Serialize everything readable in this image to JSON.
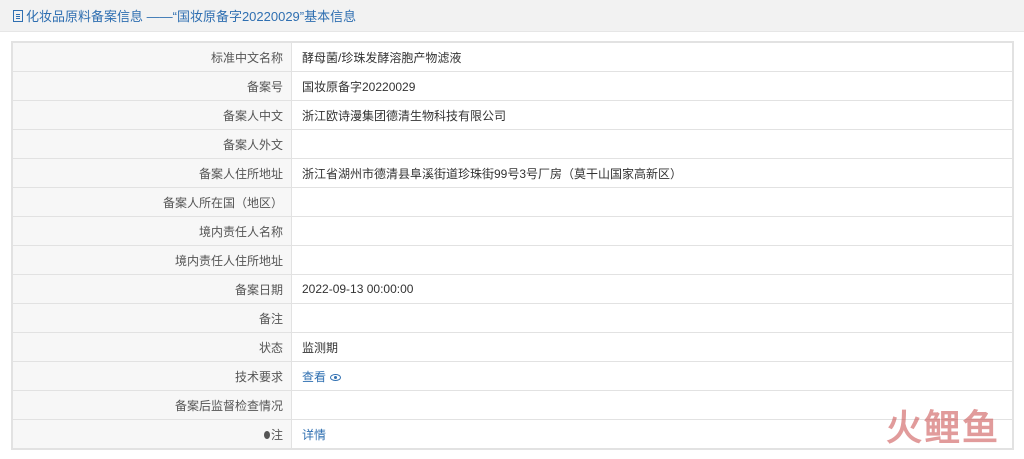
{
  "header": {
    "title": "化妆品原料备案信息 ——“国妆原备字20220029”基本信息"
  },
  "rows": [
    {
      "label": "标准中文名称",
      "value": "酵母菌/珍珠发酵溶胞产物滤液"
    },
    {
      "label": "备案号",
      "value": "国妆原备字20220029"
    },
    {
      "label": "备案人中文",
      "value": "浙江欧诗漫集团德清生物科技有限公司"
    },
    {
      "label": "备案人外文",
      "value": ""
    },
    {
      "label": "备案人住所地址",
      "value": "浙江省湖州市德清县阜溪街道珍珠街99号3号厂房（莫干山国家高新区）"
    },
    {
      "label": "备案人所在国（地区）",
      "value": ""
    },
    {
      "label": "境内责任人名称",
      "value": ""
    },
    {
      "label": "境内责任人住所地址",
      "value": ""
    },
    {
      "label": "备案日期",
      "value": "2022-09-13 00:00:00"
    },
    {
      "label": "备注",
      "value": ""
    },
    {
      "label": "状态",
      "value": "监测期"
    },
    {
      "label": "技术要求",
      "value": "查看"
    },
    {
      "label": "备案后监督检查情况",
      "value": ""
    },
    {
      "label": "注",
      "value": "详情"
    }
  ],
  "watermark": "火鲤鱼",
  "colors": {
    "link": "#2f6fb1",
    "header_bg": "#f2f2f2",
    "label_bg": "#f7f7f7",
    "border": "#e2e2e2"
  },
  "icons": {
    "header": "document-icon",
    "tech_link": "eye-icon",
    "note": "pin-icon"
  }
}
